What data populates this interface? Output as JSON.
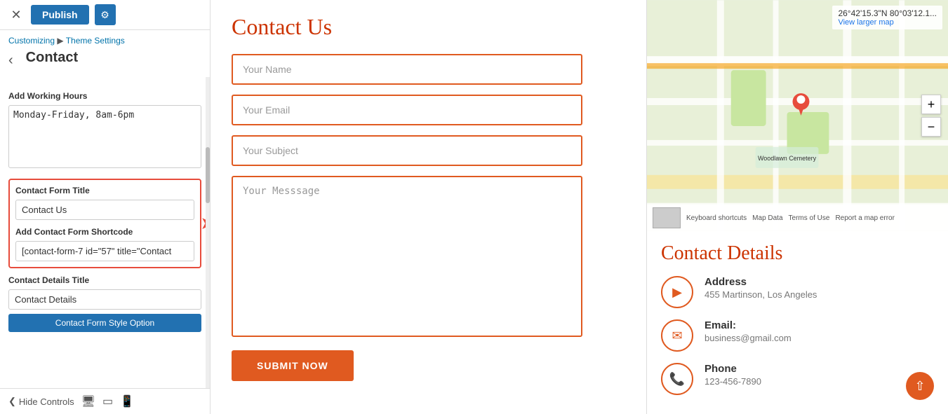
{
  "topBar": {
    "closeLabel": "✕",
    "publishLabel": "Publish",
    "gearLabel": "⚙"
  },
  "breadcrumb": {
    "customizing": "Customizing",
    "separator": " ▶ ",
    "themeSettings": "Theme Settings"
  },
  "panelTitle": "Contact",
  "workingHours": {
    "label": "Add Working Hours",
    "value": "Monday-Friday, 8am-6pm"
  },
  "contactFormTitle": {
    "label": "Contact Form Title",
    "value": "Contact Us"
  },
  "contactFormShortcode": {
    "label": "Add Contact Form Shortcode",
    "value": "[contact-form-7 id=\"57\" title=\"Contact"
  },
  "contactDetailsTitle": {
    "label": "Contact Details Title",
    "value": "Contact Details"
  },
  "contactFormBtn": {
    "label": "Contact Form Style Option"
  },
  "bottomBar": {
    "hideControls": "Hide Controls"
  },
  "mainForm": {
    "titleScript": "Contact Us",
    "namePlaceholder": "Your Name",
    "emailPlaceholder": "Your Email",
    "subjectPlaceholder": "Your Subject",
    "messagePlaceholder": "Your Messsage",
    "submitLabel": "SUBMIT NOW"
  },
  "map": {
    "coords": "26°42'15.3\"N 80°03'12.1...",
    "viewLargerMap": "View larger map",
    "zoomIn": "+",
    "zoomOut": "−",
    "keyboardShortcuts": "Keyboard shortcuts",
    "mapData": "Map Data",
    "termsOfUse": "Terms of Use",
    "reportMapError": "Report a map error"
  },
  "contactDetails": {
    "titleScript": "Contact Details",
    "address": {
      "label": "Address",
      "value": "455 Martinson, Los Angeles"
    },
    "email": {
      "label": "Email:",
      "value": "business@gmail.com"
    },
    "phone": {
      "label": "Phone",
      "value": "123-456-7890"
    }
  }
}
